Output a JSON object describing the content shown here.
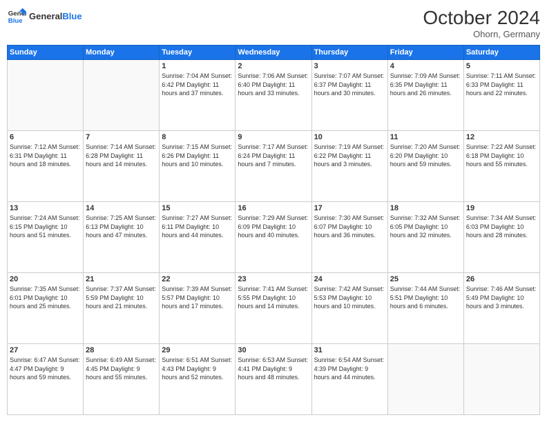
{
  "header": {
    "logo_general": "General",
    "logo_blue": "Blue",
    "month_title": "October 2024",
    "location": "Ohorn, Germany"
  },
  "days_of_week": [
    "Sunday",
    "Monday",
    "Tuesday",
    "Wednesday",
    "Thursday",
    "Friday",
    "Saturday"
  ],
  "weeks": [
    [
      {
        "day": "",
        "info": ""
      },
      {
        "day": "",
        "info": ""
      },
      {
        "day": "1",
        "info": "Sunrise: 7:04 AM\nSunset: 6:42 PM\nDaylight: 11 hours\nand 37 minutes."
      },
      {
        "day": "2",
        "info": "Sunrise: 7:06 AM\nSunset: 6:40 PM\nDaylight: 11 hours\nand 33 minutes."
      },
      {
        "day": "3",
        "info": "Sunrise: 7:07 AM\nSunset: 6:37 PM\nDaylight: 11 hours\nand 30 minutes."
      },
      {
        "day": "4",
        "info": "Sunrise: 7:09 AM\nSunset: 6:35 PM\nDaylight: 11 hours\nand 26 minutes."
      },
      {
        "day": "5",
        "info": "Sunrise: 7:11 AM\nSunset: 6:33 PM\nDaylight: 11 hours\nand 22 minutes."
      }
    ],
    [
      {
        "day": "6",
        "info": "Sunrise: 7:12 AM\nSunset: 6:31 PM\nDaylight: 11 hours\nand 18 minutes."
      },
      {
        "day": "7",
        "info": "Sunrise: 7:14 AM\nSunset: 6:28 PM\nDaylight: 11 hours\nand 14 minutes."
      },
      {
        "day": "8",
        "info": "Sunrise: 7:15 AM\nSunset: 6:26 PM\nDaylight: 11 hours\nand 10 minutes."
      },
      {
        "day": "9",
        "info": "Sunrise: 7:17 AM\nSunset: 6:24 PM\nDaylight: 11 hours\nand 7 minutes."
      },
      {
        "day": "10",
        "info": "Sunrise: 7:19 AM\nSunset: 6:22 PM\nDaylight: 11 hours\nand 3 minutes."
      },
      {
        "day": "11",
        "info": "Sunrise: 7:20 AM\nSunset: 6:20 PM\nDaylight: 10 hours\nand 59 minutes."
      },
      {
        "day": "12",
        "info": "Sunrise: 7:22 AM\nSunset: 6:18 PM\nDaylight: 10 hours\nand 55 minutes."
      }
    ],
    [
      {
        "day": "13",
        "info": "Sunrise: 7:24 AM\nSunset: 6:15 PM\nDaylight: 10 hours\nand 51 minutes."
      },
      {
        "day": "14",
        "info": "Sunrise: 7:25 AM\nSunset: 6:13 PM\nDaylight: 10 hours\nand 47 minutes."
      },
      {
        "day": "15",
        "info": "Sunrise: 7:27 AM\nSunset: 6:11 PM\nDaylight: 10 hours\nand 44 minutes."
      },
      {
        "day": "16",
        "info": "Sunrise: 7:29 AM\nSunset: 6:09 PM\nDaylight: 10 hours\nand 40 minutes."
      },
      {
        "day": "17",
        "info": "Sunrise: 7:30 AM\nSunset: 6:07 PM\nDaylight: 10 hours\nand 36 minutes."
      },
      {
        "day": "18",
        "info": "Sunrise: 7:32 AM\nSunset: 6:05 PM\nDaylight: 10 hours\nand 32 minutes."
      },
      {
        "day": "19",
        "info": "Sunrise: 7:34 AM\nSunset: 6:03 PM\nDaylight: 10 hours\nand 28 minutes."
      }
    ],
    [
      {
        "day": "20",
        "info": "Sunrise: 7:35 AM\nSunset: 6:01 PM\nDaylight: 10 hours\nand 25 minutes."
      },
      {
        "day": "21",
        "info": "Sunrise: 7:37 AM\nSunset: 5:59 PM\nDaylight: 10 hours\nand 21 minutes."
      },
      {
        "day": "22",
        "info": "Sunrise: 7:39 AM\nSunset: 5:57 PM\nDaylight: 10 hours\nand 17 minutes."
      },
      {
        "day": "23",
        "info": "Sunrise: 7:41 AM\nSunset: 5:55 PM\nDaylight: 10 hours\nand 14 minutes."
      },
      {
        "day": "24",
        "info": "Sunrise: 7:42 AM\nSunset: 5:53 PM\nDaylight: 10 hours\nand 10 minutes."
      },
      {
        "day": "25",
        "info": "Sunrise: 7:44 AM\nSunset: 5:51 PM\nDaylight: 10 hours\nand 6 minutes."
      },
      {
        "day": "26",
        "info": "Sunrise: 7:46 AM\nSunset: 5:49 PM\nDaylight: 10 hours\nand 3 minutes."
      }
    ],
    [
      {
        "day": "27",
        "info": "Sunrise: 6:47 AM\nSunset: 4:47 PM\nDaylight: 9 hours\nand 59 minutes."
      },
      {
        "day": "28",
        "info": "Sunrise: 6:49 AM\nSunset: 4:45 PM\nDaylight: 9 hours\nand 55 minutes."
      },
      {
        "day": "29",
        "info": "Sunrise: 6:51 AM\nSunset: 4:43 PM\nDaylight: 9 hours\nand 52 minutes."
      },
      {
        "day": "30",
        "info": "Sunrise: 6:53 AM\nSunset: 4:41 PM\nDaylight: 9 hours\nand 48 minutes."
      },
      {
        "day": "31",
        "info": "Sunrise: 6:54 AM\nSunset: 4:39 PM\nDaylight: 9 hours\nand 44 minutes."
      },
      {
        "day": "",
        "info": ""
      },
      {
        "day": "",
        "info": ""
      }
    ]
  ]
}
